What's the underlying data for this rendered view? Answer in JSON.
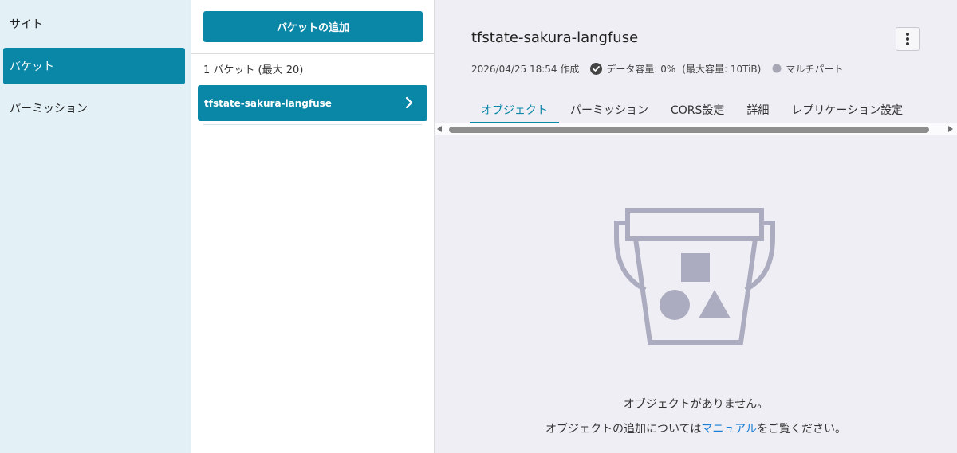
{
  "nav": {
    "items": [
      {
        "label": "サイト"
      },
      {
        "label": "バケット"
      },
      {
        "label": "パーミッション"
      }
    ]
  },
  "list": {
    "add_button": "バケットの追加",
    "count_label": "1 バケット (最大 20)",
    "buckets": [
      {
        "name": "tfstate-sakura-langfuse"
      }
    ]
  },
  "detail": {
    "title": "tfstate-sakura-langfuse",
    "created": "2026/04/25 18:54 作成",
    "capacity": "データ容量: 0%",
    "max_capacity": "(最大容量: 10TiB)",
    "multipart": "マルチパート",
    "tabs": [
      {
        "label": "オブジェクト"
      },
      {
        "label": "パーミッション"
      },
      {
        "label": "CORS設定"
      },
      {
        "label": "詳細"
      },
      {
        "label": "レプリケーション設定"
      }
    ],
    "empty_message": "オブジェクトがありません。",
    "empty_sub_before": "オブジェクトの追加については",
    "empty_sub_link": "マニュアル",
    "empty_sub_after": "をご覧ください。"
  },
  "colors": {
    "accent": "#0a87a6",
    "nav_bg": "#e3f1f7",
    "detail_bg": "#eeeef4",
    "illustration": "#acacc0",
    "link": "#1a7fd6"
  },
  "icons": {
    "chevron": "chevron-right-icon",
    "menu": "kebab-menu-icon",
    "check": "check-circle-icon",
    "status": "status-dot-icon",
    "empty": "empty-bucket-icon"
  }
}
